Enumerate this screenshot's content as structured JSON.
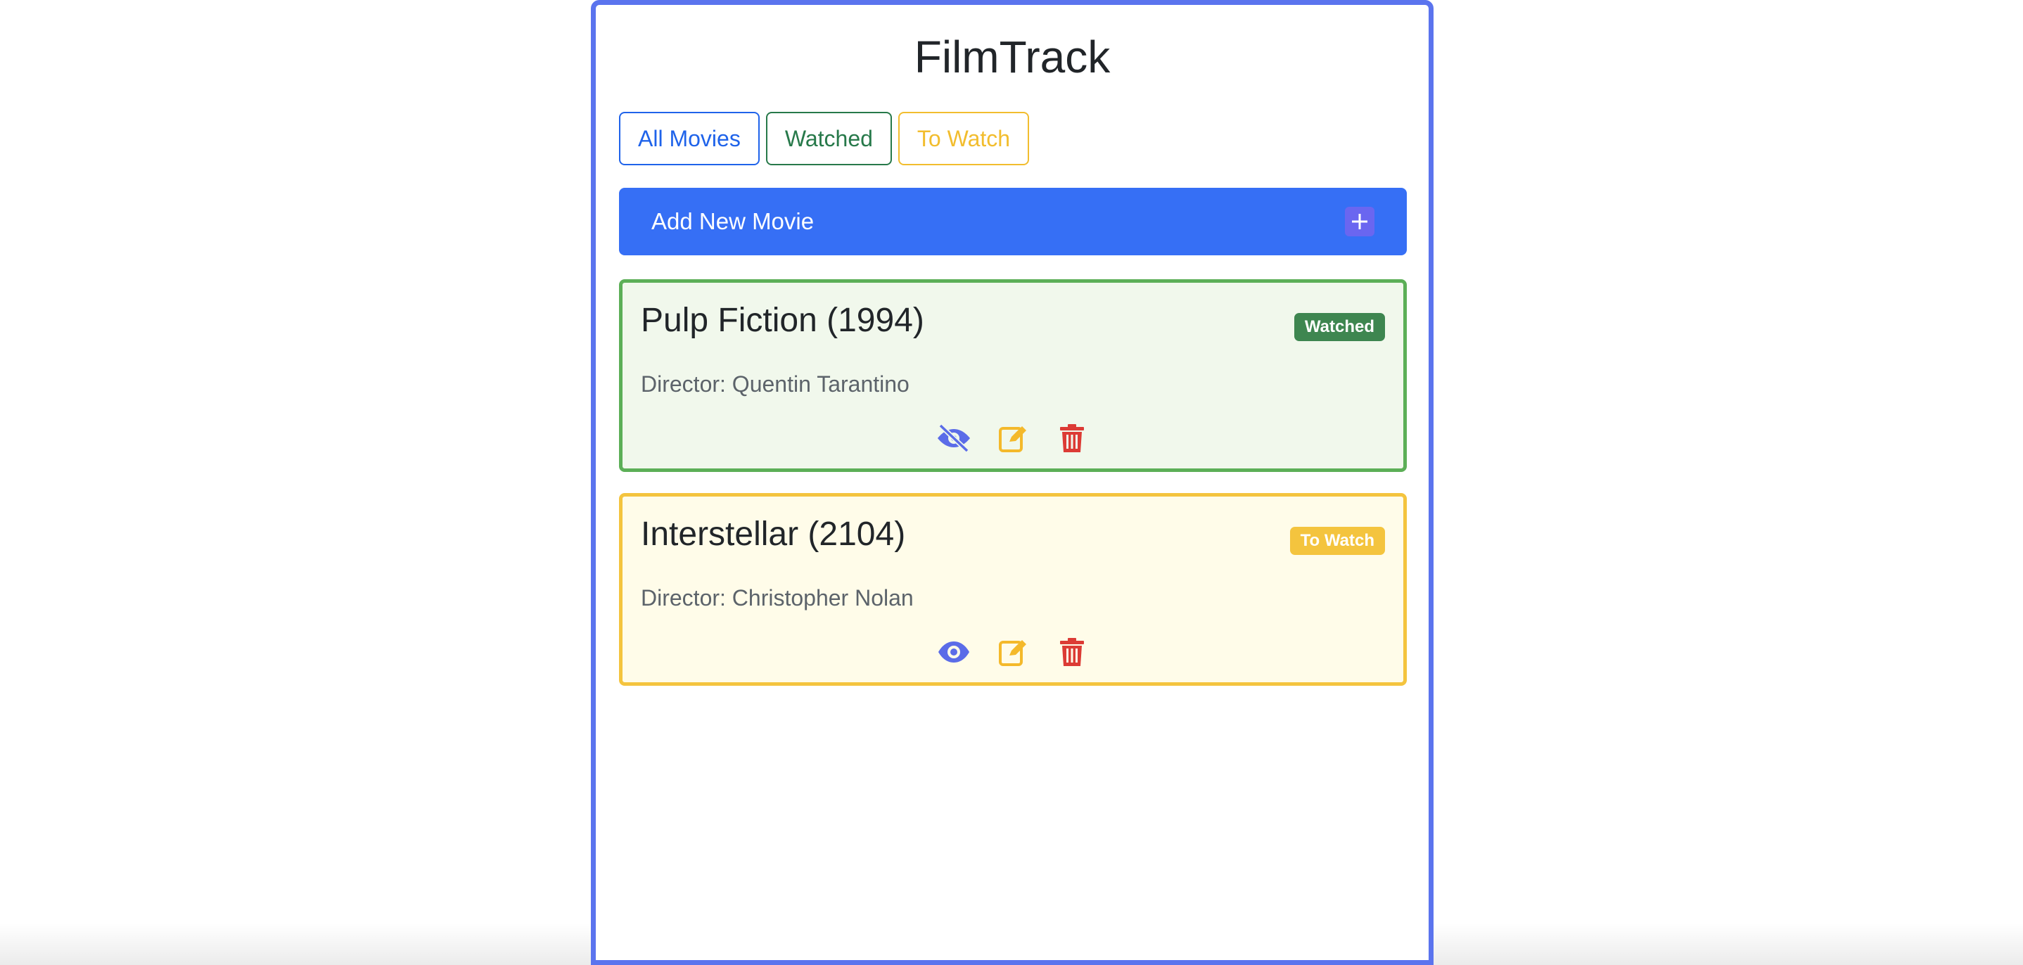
{
  "app": {
    "title": "FilmTrack"
  },
  "filters": {
    "all_label": "All Movies",
    "watched_label": "Watched",
    "to_watch_label": "To Watch"
  },
  "add_movie": {
    "label": "Add New Movie",
    "icon": "plus-icon"
  },
  "movies": [
    {
      "title": "Pulp Fiction (1994)",
      "status": "Watched",
      "director": "Director: Quentin Tarantino",
      "actions": [
        "eye-slash-icon",
        "edit-icon",
        "trash-icon"
      ]
    },
    {
      "title": "Interstellar (2104)",
      "status": "To Watch",
      "director": "Director: Christopher Nolan",
      "actions": [
        "eye-icon",
        "edit-icon",
        "trash-icon"
      ]
    }
  ],
  "colors": {
    "frame": "#5b74ee",
    "primary": "#366ff5",
    "watched": "#5caf57",
    "watched_badge": "#3e8650",
    "to_watch": "#f4c43e",
    "edit_icon": "#f4b92b",
    "delete_icon": "#dc3b35",
    "toggle_icon": "#5b6ce8"
  }
}
